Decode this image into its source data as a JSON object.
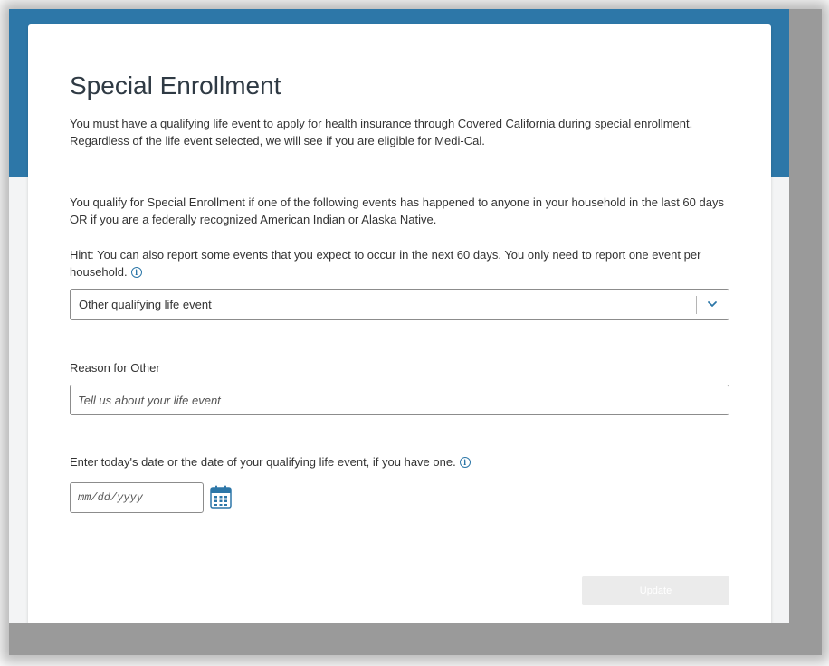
{
  "page": {
    "title": "Special Enrollment",
    "intro": "You must have a qualifying life event to apply for health insurance through Covered California during special enrollment. Regardless of the life event selected, we will see if you are eligible for Medi-Cal.",
    "qualify_text": "You qualify for Special Enrollment if one of the following events has happened to anyone in your household in the last 60 days OR if you are a federally recognized American Indian or Alaska Native.",
    "hint_text": "Hint: You can also report some events that you expect to occur in the next 60 days. You only need to report one event per household."
  },
  "life_event_select": {
    "selected": "Other qualifying life event"
  },
  "reason_field": {
    "label": "Reason for Other",
    "placeholder": "Tell us about your life event",
    "value": ""
  },
  "date_field": {
    "prompt": "Enter today's date or the date of your qualifying life event, if you have one.",
    "placeholder": "mm/dd/yyyy",
    "value": ""
  },
  "actions": {
    "update_label": "Update"
  },
  "icons": {
    "info": "info-icon",
    "chevron": "chevron-down-icon",
    "calendar": "calendar-icon"
  },
  "colors": {
    "brand_blue": "#2d77a8",
    "page_background": "#f3f4f5",
    "disabled_button": "#ebebeb"
  }
}
